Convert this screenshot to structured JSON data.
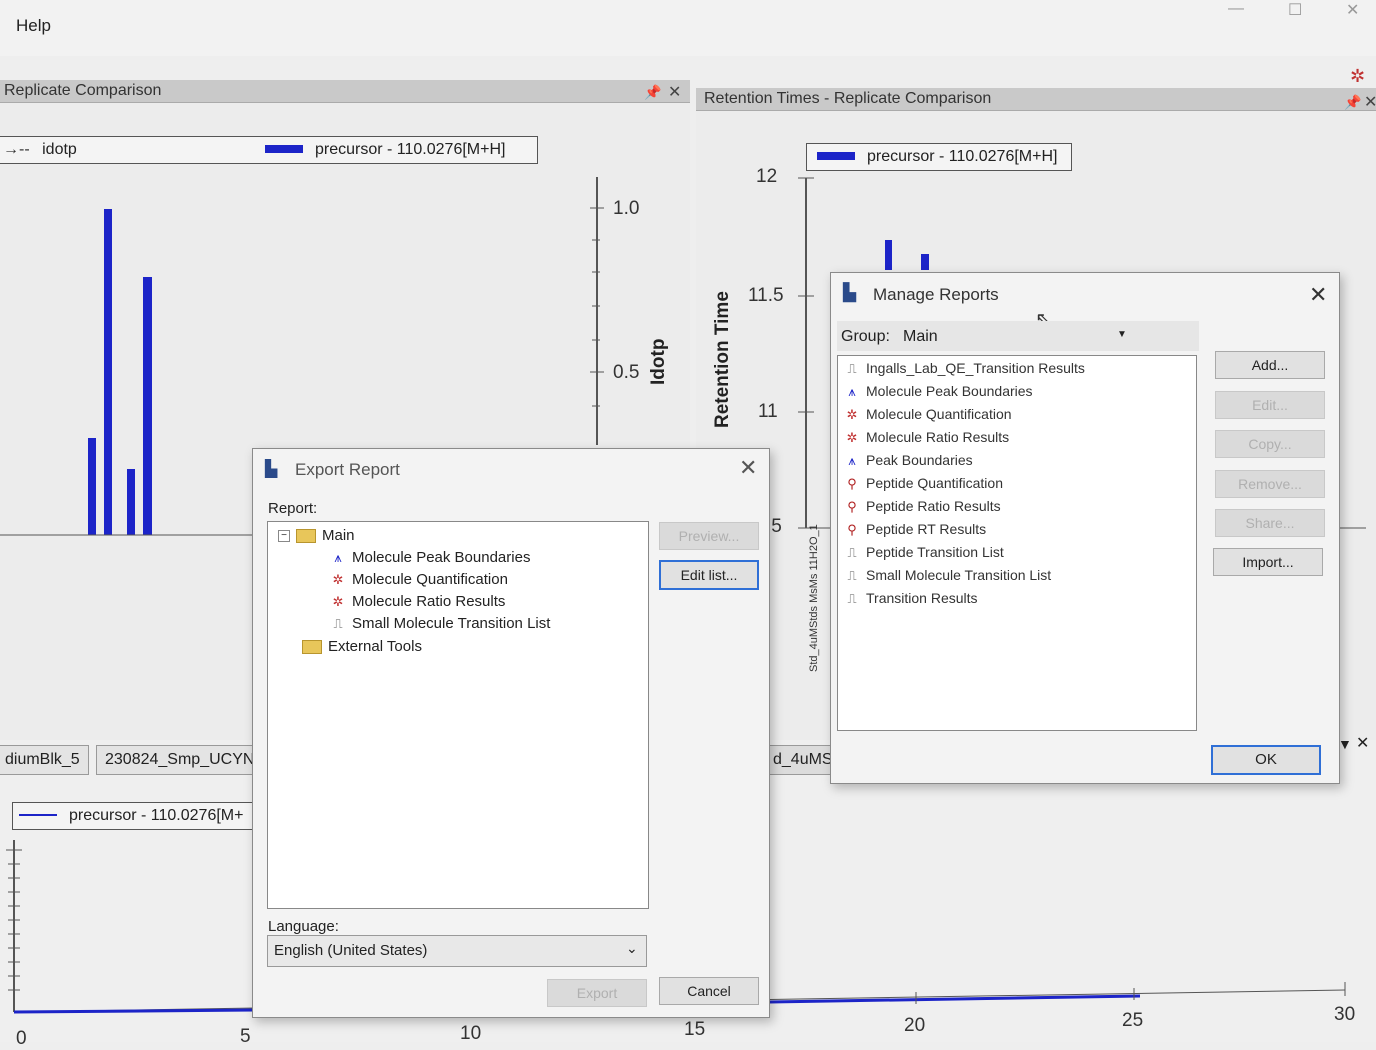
{
  "menu": {
    "help": "Help"
  },
  "left_panel": {
    "title": "Replicate Comparison",
    "legend_left": "idotp",
    "legend_right": "precursor - 110.0276[M+H]",
    "y2_label": "Idotp",
    "y2_ticks": [
      "1.0",
      "0.5"
    ]
  },
  "right_panel": {
    "title": "Retention Times - Replicate Comparison",
    "legend": "precursor - 110.0276[M+H]",
    "ylabel": "Retention Time",
    "y_ticks": [
      "12",
      "11.5",
      "11",
      ".5"
    ],
    "vertical_text": "Std_4uMStds MsMs 11H2O_1"
  },
  "bottom_tabs": [
    "diumBlk_5",
    "230824_Smp_UCYN",
    "d_4uMSt"
  ],
  "bottom_panel": {
    "legend": "precursor - 110.0276[M+",
    "x_ticks": [
      "0",
      "5",
      "10",
      "15",
      "20",
      "25",
      "30"
    ]
  },
  "export_report": {
    "title": "Export Report",
    "report_label": "Report:",
    "tree": {
      "main": "Main",
      "children": [
        "Molecule Peak Boundaries",
        "Molecule Quantification",
        "Molecule Ratio Results",
        "Small Molecule Transition List"
      ],
      "external": "External Tools"
    },
    "preview": "Preview...",
    "edit_list": "Edit list...",
    "language_label": "Language:",
    "language_value": "English (United States)",
    "export": "Export",
    "cancel": "Cancel"
  },
  "manage_reports": {
    "title": "Manage Reports",
    "group_label": "Group:",
    "group_value": "Main",
    "items": [
      "Ingalls_Lab_QE_Transition Results",
      "Molecule Peak Boundaries",
      "Molecule Quantification",
      "Molecule Ratio Results",
      "Peak Boundaries",
      "Peptide Quantification",
      "Peptide Ratio Results",
      "Peptide RT Results",
      "Peptide Transition List",
      "Small Molecule Transition List",
      "Transition Results"
    ],
    "buttons": {
      "add": "Add...",
      "edit": "Edit...",
      "copy": "Copy...",
      "remove": "Remove...",
      "share": "Share...",
      "import": "Import...",
      "ok": "OK"
    }
  },
  "colors": {
    "series": "#1c24c8",
    "panel_header": "#c9c9c9",
    "focus": "#2f6fd6"
  }
}
